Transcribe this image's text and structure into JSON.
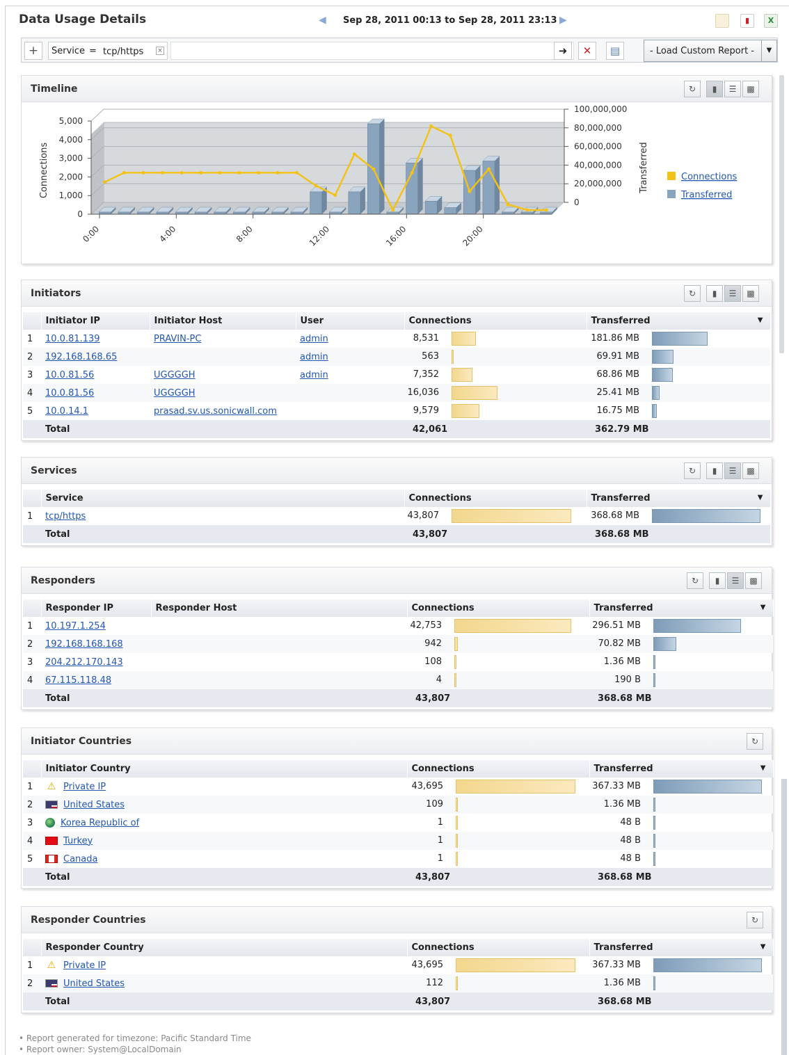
{
  "header": {
    "title": "Data Usage Details",
    "date_range": "Sep 28, 2011 00:13 to Sep 28, 2011 23:13"
  },
  "filter": {
    "key": "Service",
    "op": "=",
    "value": "tcp/https",
    "custom_report": "- Load Custom Report -"
  },
  "timeline": {
    "title": "Timeline"
  },
  "chart_data": {
    "type": "bar",
    "title": "",
    "x": [
      "0:00",
      "1:00",
      "2:00",
      "3:00",
      "4:00",
      "5:00",
      "6:00",
      "7:00",
      "8:00",
      "9:00",
      "10:00",
      "11:00",
      "12:00",
      "13:00",
      "14:00",
      "15:00",
      "16:00",
      "17:00",
      "18:00",
      "19:00",
      "20:00",
      "21:00",
      "22:00",
      "23:00"
    ],
    "xticks": [
      "0:00",
      "4:00",
      "8:00",
      "12:00",
      "16:00",
      "20:00"
    ],
    "series": [
      {
        "name": "Connections",
        "axis": "left",
        "kind": "line",
        "color": "#f2c21b",
        "values": [
          1500,
          2000,
          2000,
          2000,
          2000,
          2000,
          2000,
          2000,
          2000,
          2000,
          2000,
          1300,
          800,
          3000,
          2200,
          0,
          2000,
          4500,
          4000,
          1000,
          2200,
          300,
          0,
          0
        ]
      },
      {
        "name": "Transferred",
        "axis": "right",
        "kind": "bar3d",
        "color": "#8aa4bd",
        "values": [
          0,
          0,
          0,
          0,
          0,
          0,
          0,
          0,
          0,
          0,
          0,
          24000000,
          0,
          24000000,
          97000000,
          0,
          55000000,
          14000000,
          7000000,
          47000000,
          57000000,
          2000000,
          0,
          0
        ]
      }
    ],
    "ylabel": "Connections",
    "ylabel_right": "Transferred",
    "ylim": [
      0,
      5000
    ],
    "yticks": [
      "0",
      "1,000",
      "2,000",
      "3,000",
      "4,000",
      "5,000"
    ],
    "ylim_right": [
      0,
      100000000
    ],
    "yticks_right": [
      "0",
      "20,000,000",
      "40,000,000",
      "60,000,000",
      "80,000,000",
      "100,000,000"
    ],
    "grid": true,
    "legend": "right"
  },
  "initiators": {
    "title": "Initiators",
    "columns": [
      "Initiator IP",
      "Initiator Host",
      "User",
      "Connections",
      "Transferred"
    ],
    "rows": [
      {
        "n": "1",
        "ip": "10.0.81.139",
        "host": "PRAVIN-PC",
        "user": "admin",
        "conn": "8,531",
        "conn_frac": 0.53,
        "xfer": "181.86 MB",
        "xfer_frac": 1.0
      },
      {
        "n": "2",
        "ip": "192.168.168.65",
        "host": "",
        "user": "admin",
        "conn": "563",
        "conn_frac": 0.035,
        "xfer": "69.91 MB",
        "xfer_frac": 0.39
      },
      {
        "n": "3",
        "ip": "10.0.81.56",
        "host": "UGGGGH",
        "user": "admin",
        "conn": "7,352",
        "conn_frac": 0.46,
        "xfer": "68.86 MB",
        "xfer_frac": 0.38
      },
      {
        "n": "4",
        "ip": "10.0.81.56",
        "host": "UGGGGH",
        "user": "",
        "conn": "16,036",
        "conn_frac": 1.0,
        "xfer": "25.41 MB",
        "xfer_frac": 0.14
      },
      {
        "n": "5",
        "ip": "10.0.14.1",
        "host": "prasad.sv.us.sonicwall.com",
        "user": "",
        "conn": "9,579",
        "conn_frac": 0.6,
        "xfer": "16.75 MB",
        "xfer_frac": 0.09
      }
    ],
    "total_label": "Total",
    "total_conn": "42,061",
    "total_xfer": "362.79 MB"
  },
  "services": {
    "title": "Services",
    "columns": [
      "Service",
      "Connections",
      "Transferred"
    ],
    "rows": [
      {
        "n": "1",
        "name": "tcp/https",
        "conn": "43,807",
        "conn_frac": 1.0,
        "xfer": "368.68 MB",
        "xfer_frac": 1.0
      }
    ],
    "total_label": "Total",
    "total_conn": "43,807",
    "total_xfer": "368.68 MB"
  },
  "responders": {
    "title": "Responders",
    "columns": [
      "Responder IP",
      "Responder Host",
      "Connections",
      "Transferred"
    ],
    "rows": [
      {
        "n": "1",
        "ip": "10.197.1.254",
        "conn": "42,753",
        "conn_frac": 1.0,
        "xfer": "296.51 MB",
        "xfer_frac": 1.0
      },
      {
        "n": "2",
        "ip": "192.168.168.168",
        "conn": "942",
        "conn_frac": 0.03,
        "xfer": "70.82 MB",
        "xfer_frac": 0.26
      },
      {
        "n": "3",
        "ip": "204.212.170.143",
        "conn": "108",
        "conn_frac": 0.01,
        "xfer": "1.36 MB",
        "xfer_frac": 0.01
      },
      {
        "n": "4",
        "ip": "67.115.118.48",
        "conn": "4",
        "conn_frac": 0.01,
        "xfer": "190 B",
        "xfer_frac": 0.01
      }
    ],
    "total_label": "Total",
    "total_conn": "43,807",
    "total_xfer": "368.68 MB"
  },
  "initiator_countries": {
    "title": "Initiator Countries",
    "columns": [
      "Initiator Country",
      "Connections",
      "Transferred"
    ],
    "rows": [
      {
        "n": "1",
        "flag": "warning-icon",
        "name": "Private IP",
        "conn": "43,695",
        "conn_frac": 1.0,
        "xfer": "367.33 MB",
        "xfer_frac": 1.0
      },
      {
        "n": "2",
        "flag": "us-flag-icon",
        "name": "United States",
        "conn": "109",
        "conn_frac": 0.01,
        "xfer": "1.36 MB",
        "xfer_frac": 0.01
      },
      {
        "n": "3",
        "flag": "globe-icon",
        "name": "Korea Republic of",
        "conn": "1",
        "conn_frac": 0.01,
        "xfer": "48 B",
        "xfer_frac": 0.01
      },
      {
        "n": "4",
        "flag": "turkey-flag-icon",
        "name": "Turkey",
        "conn": "1",
        "conn_frac": 0.01,
        "xfer": "48 B",
        "xfer_frac": 0.01
      },
      {
        "n": "5",
        "flag": "canada-flag-icon",
        "name": "Canada",
        "conn": "1",
        "conn_frac": 0.01,
        "xfer": "48 B",
        "xfer_frac": 0.01
      }
    ],
    "total_label": "Total",
    "total_conn": "43,807",
    "total_xfer": "368.68 MB"
  },
  "responder_countries": {
    "title": "Responder Countries",
    "columns": [
      "Responder Country",
      "Connections",
      "Transferred"
    ],
    "rows": [
      {
        "n": "1",
        "flag": "warning-icon",
        "name": "Private IP",
        "conn": "43,695",
        "conn_frac": 1.0,
        "xfer": "367.33 MB",
        "xfer_frac": 1.0
      },
      {
        "n": "2",
        "flag": "us-flag-icon",
        "name": "United States",
        "conn": "112",
        "conn_frac": 0.01,
        "xfer": "1.36 MB",
        "xfer_frac": 0.01
      }
    ],
    "total_label": "Total",
    "total_conn": "43,807",
    "total_xfer": "368.68 MB"
  },
  "footer": {
    "line1": "Report generated for timezone: Pacific Standard Time",
    "line2": "Report owner: System@LocalDomain"
  },
  "colors": {
    "connections": "#f2c21b",
    "transferred": "#8aa4bd",
    "link": "#2257b3"
  }
}
